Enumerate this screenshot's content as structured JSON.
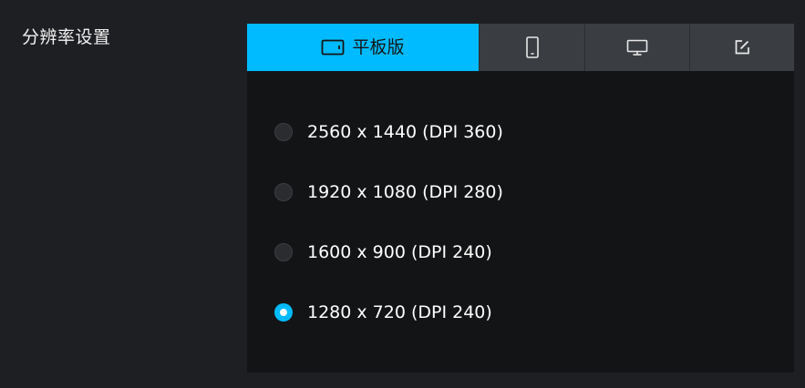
{
  "section": {
    "label": "分辨率设置"
  },
  "tabs": [
    {
      "label": "平板版",
      "icon": "tablet-icon",
      "active": true
    },
    {
      "label": "",
      "icon": "phone-icon",
      "active": false
    },
    {
      "label": "",
      "icon": "monitor-icon",
      "active": false
    },
    {
      "label": "",
      "icon": "edit-icon",
      "active": false
    }
  ],
  "resolutions": [
    {
      "label": "2560 x 1440 (DPI 360)",
      "selected": false
    },
    {
      "label": "1920 x 1080 (DPI 280)",
      "selected": false
    },
    {
      "label": "1600 x 900 (DPI 240)",
      "selected": false
    },
    {
      "label": "1280 x 720 (DPI 240)",
      "selected": true
    }
  ],
  "colors": {
    "accent": "#00bbff",
    "page_background": "#1e1f23",
    "panel_background": "#131416",
    "tab_inactive": "#3a3d42"
  }
}
